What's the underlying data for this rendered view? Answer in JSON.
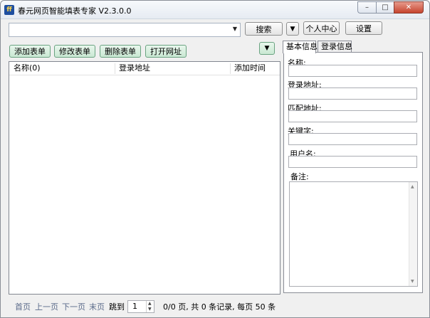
{
  "window": {
    "title": "春元网页智能填表专家 V2.3.0.0",
    "icon_text": "ff",
    "close": "✕",
    "maximize": "□",
    "minimize": "–"
  },
  "search": {
    "button": "搜索",
    "dropdown_glyph": "▼"
  },
  "header": {
    "personal_center": "个人中心",
    "settings": "设置"
  },
  "toolbar": {
    "add": "添加表单",
    "edit": "修改表单",
    "delete": "删除表单",
    "open": "打开网址",
    "down_glyph": "▼"
  },
  "list": {
    "columns": [
      "名称(0)",
      "登录地址",
      "添加时间"
    ],
    "rows": []
  },
  "tabs": [
    "基本信息",
    "登录信息"
  ],
  "form": {
    "name_label": "名称:",
    "login_url_label": "登录地址:",
    "match_url_label": "匹配地址:",
    "keyword_label": "关键字:",
    "username_label": "用户名:",
    "note_label": "备注:"
  },
  "pager": {
    "first": "首页",
    "prev": "上一页",
    "next": "下一页",
    "last": "末页",
    "jump": "跳到",
    "page_value": "1",
    "summary": "0/0 页, 共 0 条记录, 每页 50 条"
  }
}
